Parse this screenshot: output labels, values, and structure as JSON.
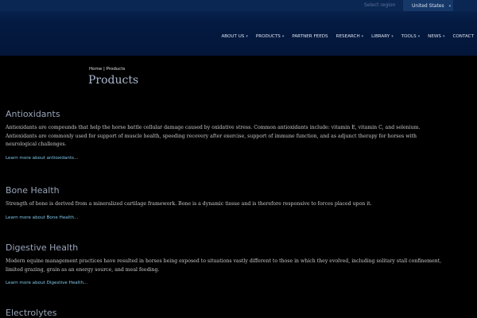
{
  "header": {
    "region_label": "Select region",
    "region_value": "United States",
    "nav": [
      {
        "label": "ABOUT US",
        "dropdown": true
      },
      {
        "label": "PRODUCTS",
        "dropdown": true
      },
      {
        "label": "PARTNER FEEDS",
        "dropdown": false
      },
      {
        "label": "RESEARCH",
        "dropdown": true
      },
      {
        "label": "LIBRARY",
        "dropdown": true
      },
      {
        "label": "TOOLS",
        "dropdown": true
      },
      {
        "label": "NEWS",
        "dropdown": true
      },
      {
        "label": "CONTACT",
        "dropdown": false
      }
    ]
  },
  "breadcrumb": "Home | Products",
  "page_title": "Products",
  "sections": [
    {
      "title": "Antioxidants",
      "lines": [
        "Antioxidants are compounds that help the horse battle cellular damage caused by oxidative stress. Common antioxidants include: vitamin E, vitamin C, and selenium.",
        "Antioxidants are commonly used for support of muscle health, speeding recovery after exercise, support of immune function, and as adjunct therapy for horses with",
        "neurological challenges."
      ],
      "link": "Learn more about antioxidants..."
    },
    {
      "title": "Bone Health",
      "lines": [
        "Strength of bone is derived from a mineralized cartilage framework. Bone is a dynamic tissue and is therefore responsive to forces placed upon it."
      ],
      "link": "Learn more about Bone Health..."
    },
    {
      "title": "Digestive Health",
      "lines": [
        "Modern equine management practices have resulted in horses being exposed to situations vastly different to those in which they evolved, including solitary stall confinement,",
        "limited grazing, grain as an energy source, and meal feeding."
      ],
      "link": "Learn more about Digestive Health..."
    },
    {
      "title": "Electrolytes",
      "lines": [],
      "link": ""
    }
  ]
}
